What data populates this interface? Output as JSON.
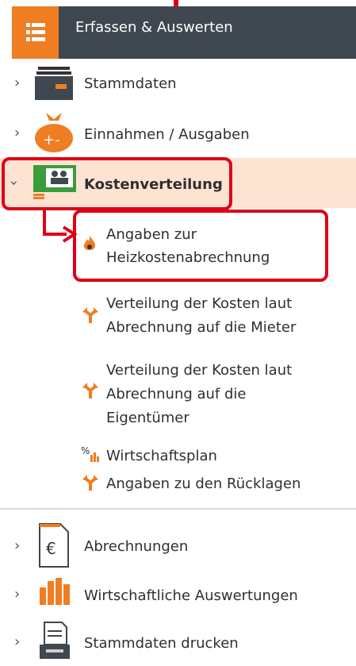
{
  "header": {
    "title": "Erfassen & Auswerten"
  },
  "tree": {
    "stammdaten": "Stammdaten",
    "einnahmen": "Einnahmen / Ausgaben",
    "kostenverteilung": "Kostenverteilung",
    "sub": {
      "heizkosten_1": "Angaben zur",
      "heizkosten_2": "Heizkostenabrechnung",
      "mieter_1": "Verteilung der Kosten laut",
      "mieter_2": "Abrechnung auf die Mieter",
      "eigentuemer_1": "Verteilung der Kosten laut",
      "eigentuemer_2": "Abrechnung auf die",
      "eigentuemer_3": "Eigentümer",
      "wirtschaftsplan": "Wirtschaftsplan",
      "ruecklagen": "Angaben zu den Rücklagen"
    },
    "abrechnungen": "Abrechnungen",
    "auswertungen": "Wirtschaftliche Auswertungen",
    "drucken": "Stammdaten drucken"
  },
  "icons": {
    "header": "list-icon",
    "stammdaten": "archive-box-icon",
    "einnahmen": "money-bag-icon",
    "kostenverteilung": "people-card-icon",
    "heizkosten": "flame-icon",
    "verteilung": "split-arrow-icon",
    "wirtschaftsplan": "percent-chart-icon",
    "abrechnungen": "euro-document-icon",
    "auswertungen": "bar-chart-icon",
    "drucken": "printer-icon"
  },
  "colors": {
    "accent": "#ef7d22",
    "header_bg": "#3f4750",
    "highlight": "#e00016",
    "selected_bg": "#fde3d2"
  }
}
